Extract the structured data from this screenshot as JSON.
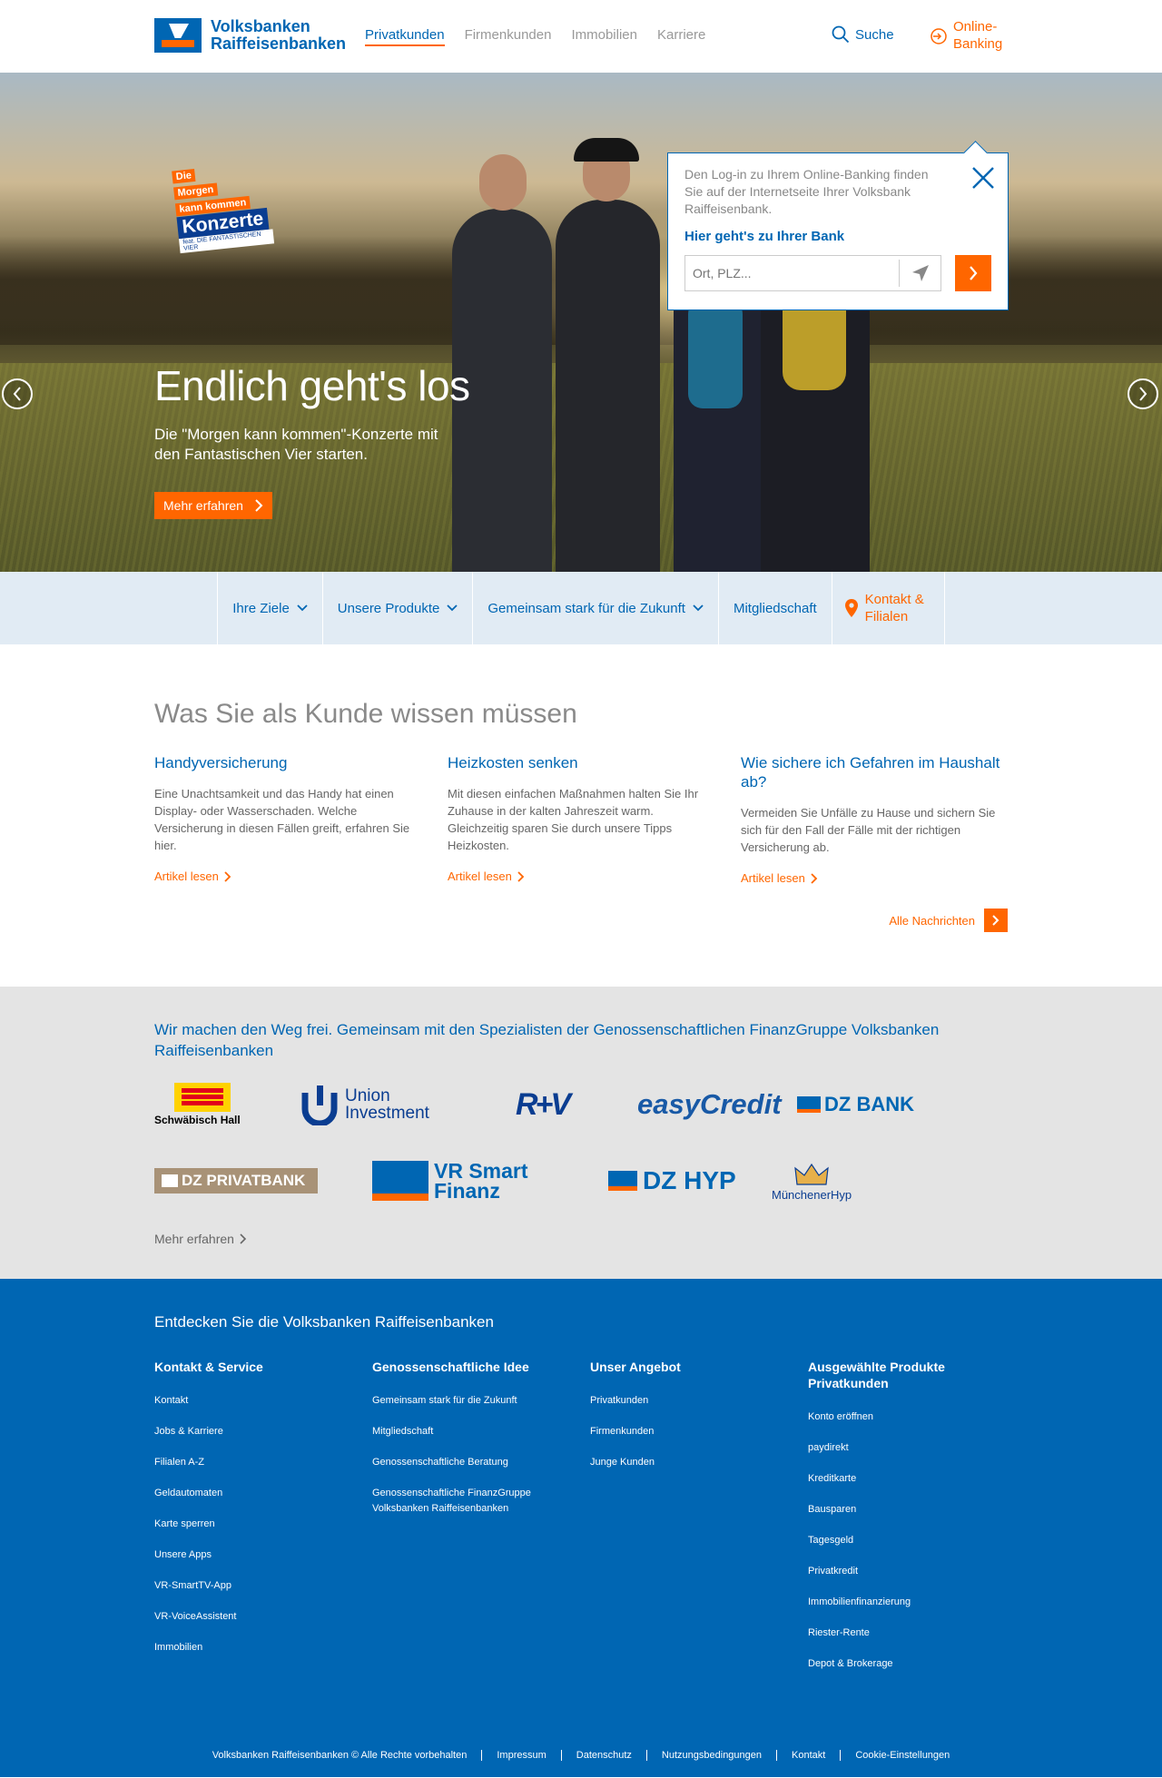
{
  "brand": {
    "line1": "Volksbanken",
    "line2": "Raiffeisenbanken",
    "blue": "#0066b3",
    "orange": "#ff6600"
  },
  "mainnav": [
    "Privatkunden",
    "Firmenkunden",
    "Immobilien",
    "Karriere"
  ],
  "header": {
    "search_label": "Suche",
    "online_banking_line1": "Online-",
    "online_banking_line2": "Banking"
  },
  "hero": {
    "badge_line1": "Die",
    "badge_line2": "Morgen",
    "badge_line3": "kann kommen",
    "badge_line4": "Konzerte",
    "badge_line5": "feat. DIE FANTASTISCHEN VIER",
    "title": "Endlich geht's los",
    "subtitle": "Die \"Morgen kann kommen\"-Konzerte mit den Fantastischen Vier starten.",
    "button": "Mehr erfahren"
  },
  "popup": {
    "text": "Den Log-in zu Ihrem Online-Banking finden Sie auf der Internetseite Ihrer Volksbank Raiffeisenbank.",
    "link": "Hier geht's zu Ihrer Bank",
    "placeholder": "Ort, PLZ..."
  },
  "subnav": {
    "items": [
      "Ihre Ziele",
      "Unsere Produkte",
      "Gemeinsam stark für die Zukunft",
      "Mitgliedschaft"
    ],
    "kontakt_line1": "Kontakt &",
    "kontakt_line2": "Filialen"
  },
  "news": {
    "title": "Was Sie als Kunde wissen müssen",
    "articles": [
      {
        "title": "Handyversicherung",
        "text": "Eine Unachtsamkeit und das Handy hat einen Display- oder Wasserschaden. Welche Versicherung in diesen Fällen greift, erfahren Sie hier.",
        "link": "Artikel lesen"
      },
      {
        "title": "Heizkosten senken",
        "text": "Mit diesen einfachen Maßnahmen halten Sie Ihr Zuhause in der kalten Jahreszeit warm. Gleichzeitig sparen Sie durch unsere Tipps Heizkosten.",
        "link": "Artikel lesen"
      },
      {
        "title": "Wie sichere ich Gefahren im Haushalt ab?",
        "text": "Vermeiden Sie Unfälle zu Hause und sichern Sie sich für den Fall der Fälle mit der richtigen Versicherung ab.",
        "link": "Artikel lesen"
      }
    ],
    "all_link": "Alle Nachrichten"
  },
  "partners": {
    "title": "Wir machen den Weg frei. Gemeinsam mit den Spezialisten der Genossenschaftlichen FinanzGruppe Volksbanken Raiffeisenbanken",
    "logos_row1": [
      "Schwäbisch Hall",
      "Union Investment",
      "R+V",
      "easyCredit",
      "DZ BANK"
    ],
    "logos_row2": [
      "DZ PRIVATBANK",
      "VR Smart Finanz",
      "DZ HYP",
      "MünchenerHyp"
    ],
    "vr_line1": "VR Smart",
    "vr_line2": "Finanz",
    "union_line1": "Union",
    "union_line2": "Investment",
    "more": "Mehr erfahren"
  },
  "footer": {
    "title": "Entdecken Sie die Volksbanken Raiffeisenbanken",
    "cols": [
      {
        "heading": "Kontakt & Service",
        "links": [
          "Kontakt",
          "Jobs & Karriere",
          "Filialen A-Z",
          "Geldautomaten",
          "Karte sperren",
          "Unsere Apps",
          "VR-SmartTV-App",
          "VR-VoiceAssistent",
          "Immobilien"
        ]
      },
      {
        "heading": "Genossenschaftliche Idee",
        "links": [
          "Gemeinsam stark für die Zukunft",
          "Mitgliedschaft",
          "Genossenschaftliche Beratung",
          "Genossenschaftliche FinanzGruppe Volksbanken Raiffeisenbanken"
        ]
      },
      {
        "heading": "Unser Angebot",
        "links": [
          "Privatkunden",
          "Firmenkunden",
          "Junge Kunden"
        ]
      },
      {
        "heading": "Ausgewählte Produkte Privatkunden",
        "links": [
          "Konto eröffnen",
          "paydirekt",
          "Kreditkarte",
          "Bausparen",
          "Tagesgeld",
          "Privatkredit",
          "Immobilienfinanzierung",
          "Riester-Rente",
          "Depot & Brokerage"
        ]
      }
    ],
    "bottom": [
      "Volksbanken Raiffeisenbanken © Alle Rechte vorbehalten",
      "Impressum",
      "Datenschutz",
      "Nutzungsbedingungen",
      "Kontakt",
      "Cookie-Einstellungen"
    ]
  }
}
